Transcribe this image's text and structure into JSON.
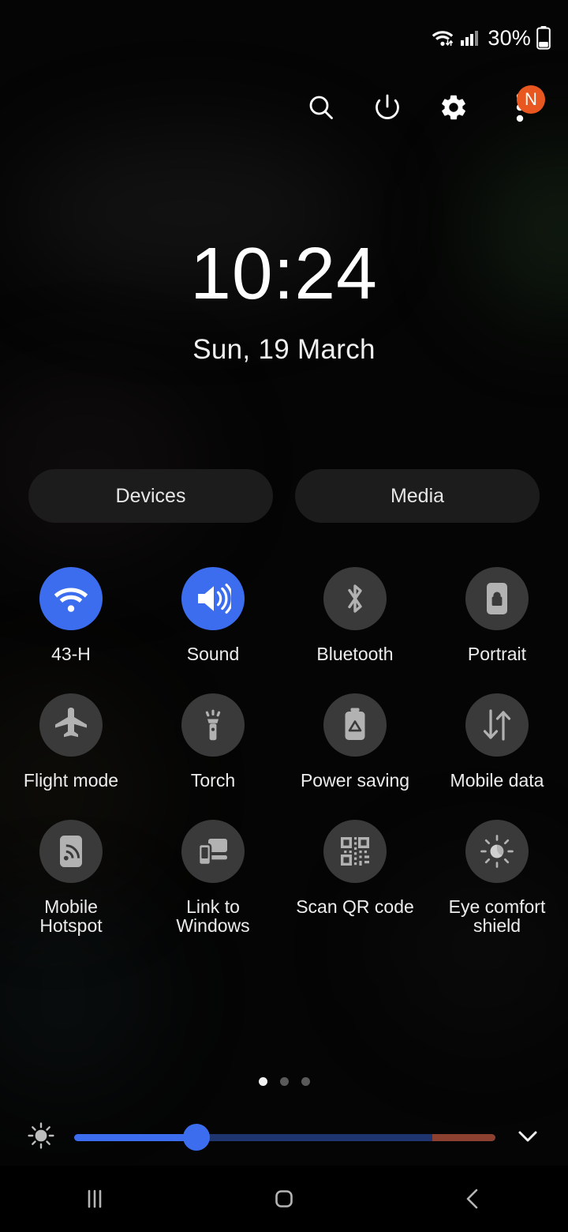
{
  "status_bar": {
    "wifi_icon": "wifi-transfer-icon",
    "signal_icon": "cellular-signal-icon",
    "battery_percent": "30%",
    "battery_icon": "battery-icon"
  },
  "header": {
    "search_icon": "search-icon",
    "power_icon": "power-icon",
    "settings_icon": "gear-icon",
    "more_icon": "more-vertical-icon",
    "badge_label": "N",
    "badge_color": "#e8571f"
  },
  "clock": {
    "time": "10:24",
    "date": "Sun, 19 March"
  },
  "shortcuts": [
    {
      "label": "Devices",
      "name": "devices-button"
    },
    {
      "label": "Media",
      "name": "media-button"
    }
  ],
  "tiles": [
    {
      "label": "43-H",
      "icon": "wifi-icon",
      "state": "on",
      "name": "tile-wifi"
    },
    {
      "label": "Sound",
      "icon": "volume-icon",
      "state": "on",
      "name": "tile-sound"
    },
    {
      "label": "Bluetooth",
      "icon": "bluetooth-icon",
      "state": "off",
      "name": "tile-bluetooth"
    },
    {
      "label": "Portrait",
      "icon": "rotation-lock-icon",
      "state": "off",
      "name": "tile-portrait"
    },
    {
      "label": "Flight mode",
      "icon": "airplane-icon",
      "state": "off",
      "name": "tile-flight-mode"
    },
    {
      "label": "Torch",
      "icon": "flashlight-icon",
      "state": "off",
      "name": "tile-torch"
    },
    {
      "label": "Power saving",
      "icon": "battery-saver-icon",
      "state": "off",
      "name": "tile-power-saving"
    },
    {
      "label": "Mobile data",
      "icon": "data-arrows-icon",
      "state": "off",
      "name": "tile-mobile-data"
    },
    {
      "label": "Mobile Hotspot",
      "icon": "hotspot-icon",
      "state": "off",
      "name": "tile-mobile-hotspot"
    },
    {
      "label": "Link to Windows",
      "icon": "link-to-windows-icon",
      "state": "off",
      "name": "tile-link-to-windows"
    },
    {
      "label": "Scan QR code",
      "icon": "qr-code-icon",
      "state": "off",
      "name": "tile-scan-qr-code"
    },
    {
      "label": "Eye comfort shield",
      "icon": "eye-comfort-icon",
      "state": "off",
      "name": "tile-eye-comfort-shield"
    }
  ],
  "pager": {
    "total_pages": 3,
    "current_page": 1
  },
  "brightness": {
    "icon": "brightness-sun-icon",
    "value_percent": 29,
    "warm_start_percent": 85,
    "expand_icon": "chevron-down-icon",
    "accent_color": "#3d6def",
    "warm_color": "#8c4030"
  },
  "navigation": {
    "recents_icon": "recents-icon",
    "home_icon": "home-icon",
    "back_icon": "back-icon"
  }
}
